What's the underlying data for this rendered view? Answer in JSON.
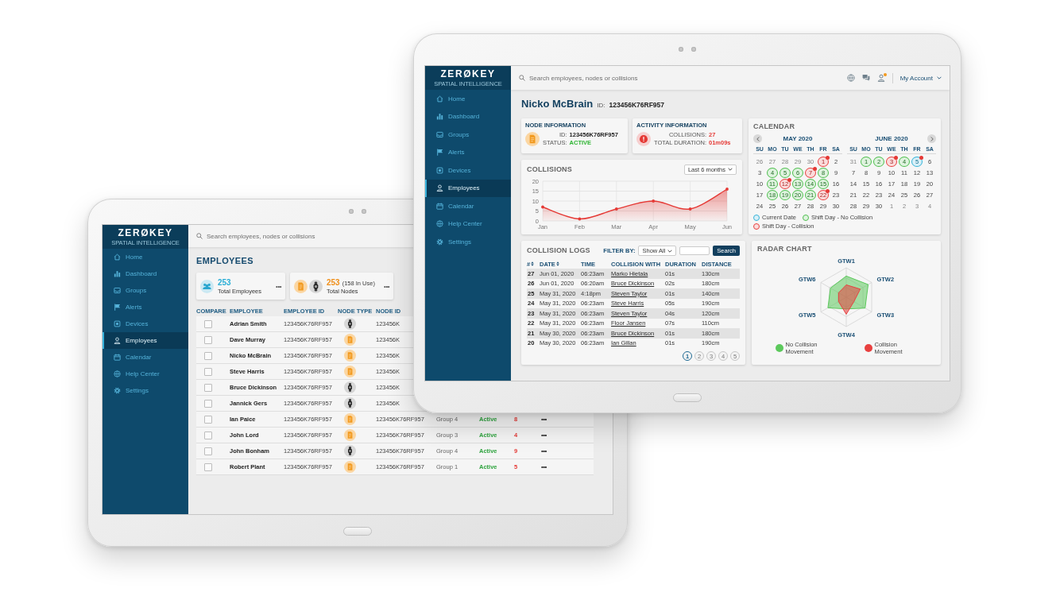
{
  "back_tablet": {
    "sidebar": {
      "wordmark": "ZERØKEY",
      "tagline": "SPATIAL INTELLIGENCE",
      "items": [
        {
          "label": "Home",
          "selected": false
        },
        {
          "label": "Dashboard",
          "selected": false
        },
        {
          "label": "Groups",
          "selected": false
        },
        {
          "label": "Alerts",
          "selected": false
        },
        {
          "label": "Devices",
          "selected": false
        },
        {
          "label": "Employees",
          "selected": true
        },
        {
          "label": "Calendar",
          "selected": false
        },
        {
          "label": "Help Center",
          "selected": false
        },
        {
          "label": "Settings",
          "selected": false
        }
      ]
    },
    "search": {
      "placeholder": "Search employees, nodes or collisions"
    },
    "title": "EMPLOYEES",
    "stat_cards": [
      {
        "kind": "employees",
        "value": "253",
        "label": "Total Employees",
        "menu": "•••"
      },
      {
        "kind": "nodes",
        "value": "253",
        "note": "(158 In Use)",
        "label": "Total Nodes",
        "menu": "•••"
      }
    ],
    "table": {
      "columns": [
        "COMPARE",
        "EMPLOYEE",
        "EMPLOYEE ID",
        "NODE TYPE",
        "NODE ID"
      ],
      "rows": [
        {
          "checked": false,
          "employee": "Adrian Smith",
          "employee_id": "123456K76RF957",
          "kind": "watch",
          "node_id": "123456K"
        },
        {
          "checked": false,
          "employee": "Dave Murray",
          "employee_id": "123456K76RF957",
          "kind": "tag",
          "node_id": "123456K"
        },
        {
          "checked": false,
          "employee": "Nicko McBrain",
          "employee_id": "123456K76RF957",
          "kind": "tag",
          "node_id": "123456K"
        },
        {
          "checked": false,
          "employee": "Steve Harris",
          "employee_id": "123456K76RF957",
          "kind": "tag",
          "node_id": "123456K"
        },
        {
          "checked": false,
          "employee": "Bruce Dickinson",
          "employee_id": "123456K76RF957",
          "kind": "watch",
          "node_id": "123456K"
        },
        {
          "checked": false,
          "employee": "Jannick Gers",
          "employee_id": "123456K76RF957",
          "kind": "watch",
          "node_id": "123456K"
        },
        {
          "checked": false,
          "employee": "Ian Paice",
          "employee_id": "123456K76RF957",
          "kind": "tag",
          "node_id": "123456K76RF957",
          "group": "Group 4",
          "status": "Active",
          "collisions": "8",
          "actions": "•••"
        },
        {
          "checked": false,
          "employee": "John Lord",
          "employee_id": "123456K76RF957",
          "kind": "tag",
          "node_id": "123456K76RF957",
          "group": "Group 3",
          "status": "Active",
          "collisions": "4",
          "actions": "•••"
        },
        {
          "checked": false,
          "employee": "John Bonham",
          "employee_id": "123456K76RF957",
          "kind": "watch",
          "node_id": "123456K76RF957",
          "group": "Group 4",
          "status": "Active",
          "collisions": "9",
          "actions": "•••"
        },
        {
          "checked": false,
          "employee": "Robert Plant",
          "employee_id": "123456K76RF957",
          "kind": "tag",
          "node_id": "123456K76RF957",
          "group": "Group 1",
          "status": "Active",
          "collisions": "5",
          "actions": "•••"
        }
      ]
    }
  },
  "front_tablet": {
    "sidebar": {
      "wordmark": "ZERØKEY",
      "tagline": "SPATIAL INTELLIGENCE",
      "items": [
        {
          "label": "Home",
          "selected": false
        },
        {
          "label": "Dashboard",
          "selected": false
        },
        {
          "label": "Groups",
          "selected": false
        },
        {
          "label": "Alerts",
          "selected": false
        },
        {
          "label": "Devices",
          "selected": false
        },
        {
          "label": "Employees",
          "selected": true
        },
        {
          "label": "Calendar",
          "selected": false
        },
        {
          "label": "Help Center",
          "selected": false
        },
        {
          "label": "Settings",
          "selected": false
        }
      ]
    },
    "search": {
      "placeholder": "Search employees, nodes or collisions"
    },
    "account": {
      "label": "My Account",
      "notification": true
    },
    "profile": {
      "name": "Nicko McBrain",
      "id_label": "ID:",
      "id": "123456K76RF957"
    },
    "node_information": {
      "title": "NODE INFORMATION",
      "kind": "tag",
      "fields": [
        {
          "label": "ID:",
          "value": "123456K76RF957",
          "kind": "plain"
        },
        {
          "label": "STATUS:",
          "value": "ACTIVE",
          "kind": "good"
        }
      ]
    },
    "activity_information": {
      "title": "ACTIVITY INFORMATION",
      "fields": [
        {
          "label": "COLLISIONS:",
          "value": "27",
          "kind": "alert"
        },
        {
          "label": "TOTAL DURATION:",
          "value": "01m09s",
          "kind": "alert"
        }
      ]
    },
    "collisions": {
      "title": "COLLISIONS",
      "range": "Last 6 months",
      "chart_data": {
        "type": "area",
        "categories": [
          "Jan",
          "Feb",
          "Mar",
          "Apr",
          "May",
          "Jun"
        ],
        "values": [
          7,
          1,
          6,
          10,
          6,
          16
        ],
        "ylim": [
          0,
          20
        ],
        "yticks": [
          0,
          5,
          10,
          15,
          20
        ],
        "grid": true
      }
    },
    "calendar": {
      "title": "CALENDAR",
      "months": [
        {
          "title": "MAY 2020",
          "kind": "prev",
          "weekdays": [
            "SU",
            "MO",
            "TU",
            "WE",
            "TH",
            "FR",
            "SA"
          ],
          "days": [
            {
              "day": "26",
              "kind": "outside",
              "alert": false
            },
            {
              "day": "27",
              "kind": "outside",
              "alert": false
            },
            {
              "day": "28",
              "kind": "outside",
              "alert": false
            },
            {
              "day": "29",
              "kind": "outside",
              "alert": false
            },
            {
              "day": "30",
              "kind": "outside",
              "alert": false
            },
            {
              "day": "1",
              "kind": "collision",
              "alert": true
            },
            {
              "day": "2",
              "kind": "plain",
              "alert": false
            },
            {
              "day": "3",
              "kind": "plain",
              "alert": false
            },
            {
              "day": "4",
              "kind": "shift",
              "alert": false
            },
            {
              "day": "5",
              "kind": "shift",
              "alert": false
            },
            {
              "day": "6",
              "kind": "shift",
              "alert": false
            },
            {
              "day": "7",
              "kind": "collision",
              "alert": true
            },
            {
              "day": "8",
              "kind": "shift",
              "alert": false
            },
            {
              "day": "9",
              "kind": "plain",
              "alert": false
            },
            {
              "day": "10",
              "kind": "plain",
              "alert": false
            },
            {
              "day": "11",
              "kind": "shift",
              "alert": false
            },
            {
              "day": "12",
              "kind": "collision",
              "alert": true
            },
            {
              "day": "13",
              "kind": "shift",
              "alert": false
            },
            {
              "day": "14",
              "kind": "shift",
              "alert": false
            },
            {
              "day": "15",
              "kind": "shift",
              "alert": false
            },
            {
              "day": "16",
              "kind": "plain",
              "alert": false
            },
            {
              "day": "17",
              "kind": "plain",
              "alert": false
            },
            {
              "day": "18",
              "kind": "shift",
              "alert": false
            },
            {
              "day": "19",
              "kind": "shift",
              "alert": false
            },
            {
              "day": "20",
              "kind": "shift",
              "alert": false
            },
            {
              "day": "21",
              "kind": "shift",
              "alert": false
            },
            {
              "day": "22",
              "kind": "collision",
              "alert": true
            },
            {
              "day": "23",
              "kind": "plain",
              "alert": false
            },
            {
              "day": "24",
              "kind": "plain",
              "alert": false
            },
            {
              "day": "25",
              "kind": "plain",
              "alert": false
            },
            {
              "day": "26",
              "kind": "plain",
              "alert": false
            },
            {
              "day": "27",
              "kind": "plain",
              "alert": false
            },
            {
              "day": "28",
              "kind": "plain",
              "alert": false
            },
            {
              "day": "29",
              "kind": "plain",
              "alert": false
            },
            {
              "day": "30",
              "kind": "plain",
              "alert": false
            }
          ]
        },
        {
          "title": "JUNE 2020",
          "kind": "next",
          "weekdays": [
            "SU",
            "MO",
            "TU",
            "WE",
            "TH",
            "FR",
            "SA"
          ],
          "days": [
            {
              "day": "31",
              "kind": "outside",
              "alert": false
            },
            {
              "day": "1",
              "kind": "shift",
              "alert": false
            },
            {
              "day": "2",
              "kind": "shift",
              "alert": false
            },
            {
              "day": "3",
              "kind": "collision",
              "alert": true
            },
            {
              "day": "4",
              "kind": "shift",
              "alert": false
            },
            {
              "day": "5",
              "kind": "today",
              "alert": true
            },
            {
              "day": "6",
              "kind": "plain",
              "alert": false
            },
            {
              "day": "7",
              "kind": "plain",
              "alert": false
            },
            {
              "day": "8",
              "kind": "plain",
              "alert": false
            },
            {
              "day": "9",
              "kind": "plain",
              "alert": false
            },
            {
              "day": "10",
              "kind": "plain",
              "alert": false
            },
            {
              "day": "11",
              "kind": "plain",
              "alert": false
            },
            {
              "day": "12",
              "kind": "plain",
              "alert": false
            },
            {
              "day": "13",
              "kind": "plain",
              "alert": false
            },
            {
              "day": "14",
              "kind": "plain",
              "alert": false
            },
            {
              "day": "15",
              "kind": "plain",
              "alert": false
            },
            {
              "day": "16",
              "kind": "plain",
              "alert": false
            },
            {
              "day": "17",
              "kind": "plain",
              "alert": false
            },
            {
              "day": "18",
              "kind": "plain",
              "alert": false
            },
            {
              "day": "19",
              "kind": "plain",
              "alert": false
            },
            {
              "day": "20",
              "kind": "plain",
              "alert": false
            },
            {
              "day": "21",
              "kind": "plain",
              "alert": false
            },
            {
              "day": "22",
              "kind": "plain",
              "alert": false
            },
            {
              "day": "23",
              "kind": "plain",
              "alert": false
            },
            {
              "day": "24",
              "kind": "plain",
              "alert": false
            },
            {
              "day": "25",
              "kind": "plain",
              "alert": false
            },
            {
              "day": "26",
              "kind": "plain",
              "alert": false
            },
            {
              "day": "27",
              "kind": "plain",
              "alert": false
            },
            {
              "day": "28",
              "kind": "plain",
              "alert": false
            },
            {
              "day": "29",
              "kind": "plain",
              "alert": false
            },
            {
              "day": "30",
              "kind": "plain",
              "alert": false
            },
            {
              "day": "1",
              "kind": "outside",
              "alert": false
            },
            {
              "day": "2",
              "kind": "outside",
              "alert": false
            },
            {
              "day": "3",
              "kind": "outside",
              "alert": false
            },
            {
              "day": "4",
              "kind": "outside",
              "alert": false
            }
          ]
        }
      ],
      "legend": [
        {
          "kind": "today",
          "label": "Current Date"
        },
        {
          "kind": "shift",
          "label": "Shift Day - No Collision"
        },
        {
          "kind": "collision",
          "label": "Shift Day - Collision"
        }
      ]
    },
    "collision_logs": {
      "title": "COLLISION LOGS",
      "filter_label": "FILTER BY:",
      "filter_value": "Show All",
      "search_button": "Search",
      "columns": [
        {
          "label": "#",
          "sortable": true
        },
        {
          "label": "DATE",
          "sortable": true
        },
        {
          "label": "TIME",
          "sortable": false
        },
        {
          "label": "COLLISION WITH",
          "sortable": false
        },
        {
          "label": "DURATION",
          "sortable": false
        },
        {
          "label": "DISTANCE",
          "sortable": false
        }
      ],
      "rows": [
        {
          "no": "27",
          "date": "Jun 01, 2020",
          "time": "06:23am",
          "with": "Marko Hietala",
          "duration": "01s",
          "distance": "130cm"
        },
        {
          "no": "26",
          "date": "Jun 01, 2020",
          "time": "06:20am",
          "with": "Bruce Dickinson",
          "duration": "02s",
          "distance": "180cm"
        },
        {
          "no": "25",
          "date": "May 31, 2020",
          "time": "4:18pm",
          "with": "Steven Taylor",
          "duration": "01s",
          "distance": "140cm"
        },
        {
          "no": "24",
          "date": "May 31, 2020",
          "time": "06:23am",
          "with": "Steve Harris",
          "duration": "05s",
          "distance": "190cm"
        },
        {
          "no": "23",
          "date": "May 31, 2020",
          "time": "06:23am",
          "with": "Steven Taylor",
          "duration": "04s",
          "distance": "120cm"
        },
        {
          "no": "22",
          "date": "May 31, 2020",
          "time": "06:23am",
          "with": "Floor Jansen",
          "duration": "07s",
          "distance": "110cm"
        },
        {
          "no": "21",
          "date": "May 30, 2020",
          "time": "06:23am",
          "with": "Bruce Dickinson",
          "duration": "01s",
          "distance": "180cm"
        },
        {
          "no": "20",
          "date": "May 30, 2020",
          "time": "06:23am",
          "with": "Ian Gillan",
          "duration": "01s",
          "distance": "190cm"
        }
      ],
      "pages": [
        {
          "label": "1",
          "selected": true
        },
        {
          "label": "2",
          "selected": false
        },
        {
          "label": "3",
          "selected": false
        },
        {
          "label": "4",
          "selected": false
        },
        {
          "label": "5",
          "selected": false
        }
      ]
    },
    "radar_chart": {
      "title": "RADAR CHART",
      "axes": [
        "GTW1",
        "GTW2",
        "GTW3",
        "GTW4",
        "GTW5",
        "GTW6"
      ],
      "legend": [
        {
          "label": "No Collision Movement",
          "color": "#5cc95c"
        },
        {
          "label": "Collision Movement",
          "color": "#e8403f"
        }
      ]
    }
  }
}
